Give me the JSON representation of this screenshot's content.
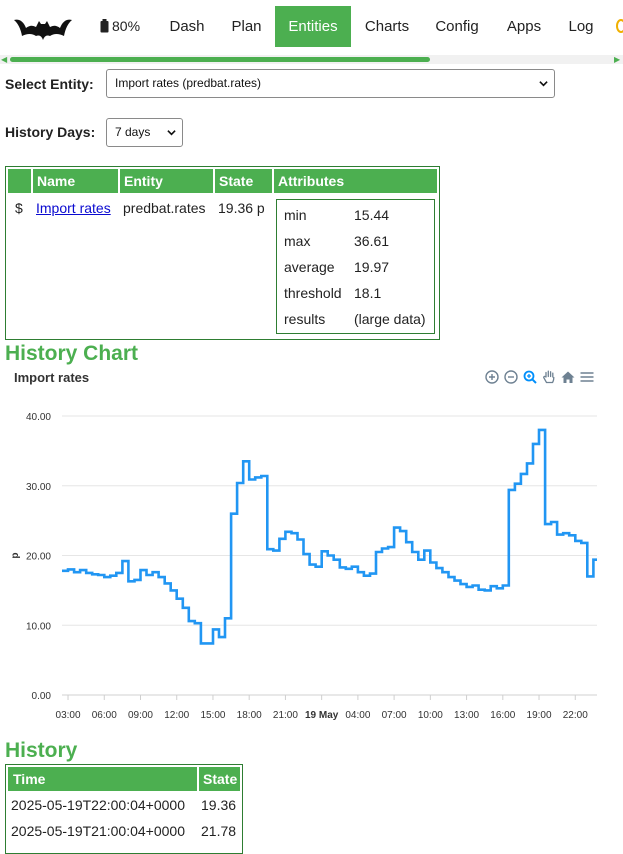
{
  "nav": {
    "battery": "80%",
    "items": [
      "Dash",
      "Plan",
      "Entities",
      "Charts",
      "Config",
      "Apps",
      "Log"
    ],
    "active": "Entities"
  },
  "entity_select": {
    "label": "Select Entity:",
    "value": "Import rates (predbat.rates)"
  },
  "history_days": {
    "label": "History Days:",
    "value": "7 days"
  },
  "entity_table": {
    "headers": [
      "Name",
      "Entity",
      "State",
      "Attributes"
    ],
    "row": {
      "icon": "$",
      "name": "Import rates",
      "entity": "predbat.rates",
      "state": "19.36 p",
      "attributes": [
        {
          "key": "min",
          "value": "15.44"
        },
        {
          "key": "max",
          "value": "36.61"
        },
        {
          "key": "average",
          "value": "19.97"
        },
        {
          "key": "threshold",
          "value": "18.1"
        },
        {
          "key": "results",
          "value": "(large data)"
        }
      ]
    }
  },
  "history_chart": {
    "heading": "History Chart"
  },
  "chart_data": {
    "type": "line",
    "title": "Import rates",
    "ylabel": "p",
    "ylim": [
      0,
      40
    ],
    "yticks": [
      "0.00",
      "10.00",
      "20.00",
      "30.00",
      "40.00"
    ],
    "xticks": [
      "03:00",
      "06:00",
      "09:00",
      "12:00",
      "15:00",
      "18:00",
      "21:00",
      "19 May",
      "04:00",
      "07:00",
      "10:00",
      "13:00",
      "16:00",
      "19:00",
      "22:00"
    ],
    "x_start_hour": 2.5,
    "x_end_hour": 46.8,
    "series": [
      {
        "step": true,
        "points": [
          [
            2.5,
            17.8
          ],
          [
            3.0,
            18.0
          ],
          [
            3.5,
            17.6
          ],
          [
            4.0,
            17.9
          ],
          [
            4.5,
            17.5
          ],
          [
            5.0,
            17.3
          ],
          [
            5.5,
            17.2
          ],
          [
            6.0,
            16.9
          ],
          [
            6.5,
            17.1
          ],
          [
            7.0,
            17.5
          ],
          [
            7.5,
            19.2
          ],
          [
            8.0,
            16.3
          ],
          [
            8.5,
            16.5
          ],
          [
            9.0,
            17.9
          ],
          [
            9.5,
            17.2
          ],
          [
            10.0,
            17.6
          ],
          [
            10.5,
            16.9
          ],
          [
            11.0,
            16.0
          ],
          [
            11.5,
            15.0
          ],
          [
            12.0,
            13.8
          ],
          [
            12.5,
            12.5
          ],
          [
            13.0,
            10.6
          ],
          [
            13.5,
            10.3
          ],
          [
            14.0,
            7.4
          ],
          [
            15.0,
            9.4
          ],
          [
            15.5,
            8.3
          ],
          [
            16.0,
            11.0
          ],
          [
            16.5,
            26.0
          ],
          [
            17.0,
            30.4
          ],
          [
            17.5,
            33.5
          ],
          [
            18.0,
            30.9
          ],
          [
            18.5,
            31.2
          ],
          [
            19.0,
            31.4
          ],
          [
            19.5,
            20.9
          ],
          [
            20.0,
            20.7
          ],
          [
            20.5,
            22.4
          ],
          [
            21.0,
            23.4
          ],
          [
            21.5,
            23.2
          ],
          [
            22.0,
            22.3
          ],
          [
            22.5,
            20.2
          ],
          [
            23.0,
            18.7
          ],
          [
            23.5,
            18.4
          ],
          [
            24.0,
            20.6
          ],
          [
            24.5,
            20.0
          ],
          [
            25.0,
            19.4
          ],
          [
            25.5,
            18.3
          ],
          [
            26.0,
            18.1
          ],
          [
            26.5,
            18.4
          ],
          [
            27.0,
            17.6
          ],
          [
            27.5,
            17.1
          ],
          [
            28.0,
            17.4
          ],
          [
            28.5,
            20.5
          ],
          [
            29.0,
            21.0
          ],
          [
            29.5,
            21.2
          ],
          [
            30.0,
            24.0
          ],
          [
            30.5,
            23.5
          ],
          [
            31.0,
            21.9
          ],
          [
            31.5,
            20.5
          ],
          [
            32.0,
            19.4
          ],
          [
            32.5,
            20.7
          ],
          [
            33.0,
            19.0
          ],
          [
            33.5,
            18.2
          ],
          [
            34.0,
            17.6
          ],
          [
            34.5,
            16.9
          ],
          [
            35.0,
            16.4
          ],
          [
            35.5,
            15.9
          ],
          [
            36.0,
            15.5
          ],
          [
            36.5,
            15.7
          ],
          [
            37.0,
            15.1
          ],
          [
            37.5,
            15.0
          ],
          [
            38.0,
            15.6
          ],
          [
            38.5,
            15.3
          ],
          [
            39.0,
            15.7
          ],
          [
            39.5,
            29.4
          ],
          [
            40.0,
            30.3
          ],
          [
            40.5,
            31.7
          ],
          [
            41.0,
            33.2
          ],
          [
            41.5,
            36.0
          ],
          [
            42.0,
            38.0
          ],
          [
            42.5,
            24.5
          ],
          [
            43.0,
            24.8
          ],
          [
            43.5,
            23.0
          ],
          [
            44.0,
            23.2
          ],
          [
            44.5,
            22.9
          ],
          [
            45.0,
            22.1
          ],
          [
            45.5,
            21.8
          ],
          [
            46.0,
            17.0
          ],
          [
            46.5,
            19.4
          ],
          [
            46.8,
            19.4
          ]
        ]
      }
    ]
  },
  "history": {
    "heading": "History",
    "headers": [
      "Time",
      "State"
    ],
    "rows": [
      [
        "2025-05-19T22:00:04+0000",
        "19.36"
      ],
      [
        "2025-05-19T21:00:04+0000",
        "21.78"
      ]
    ]
  },
  "colors": {
    "accent": "#4CAF50",
    "line": "#2196F3",
    "link": "#0a0ad0"
  }
}
